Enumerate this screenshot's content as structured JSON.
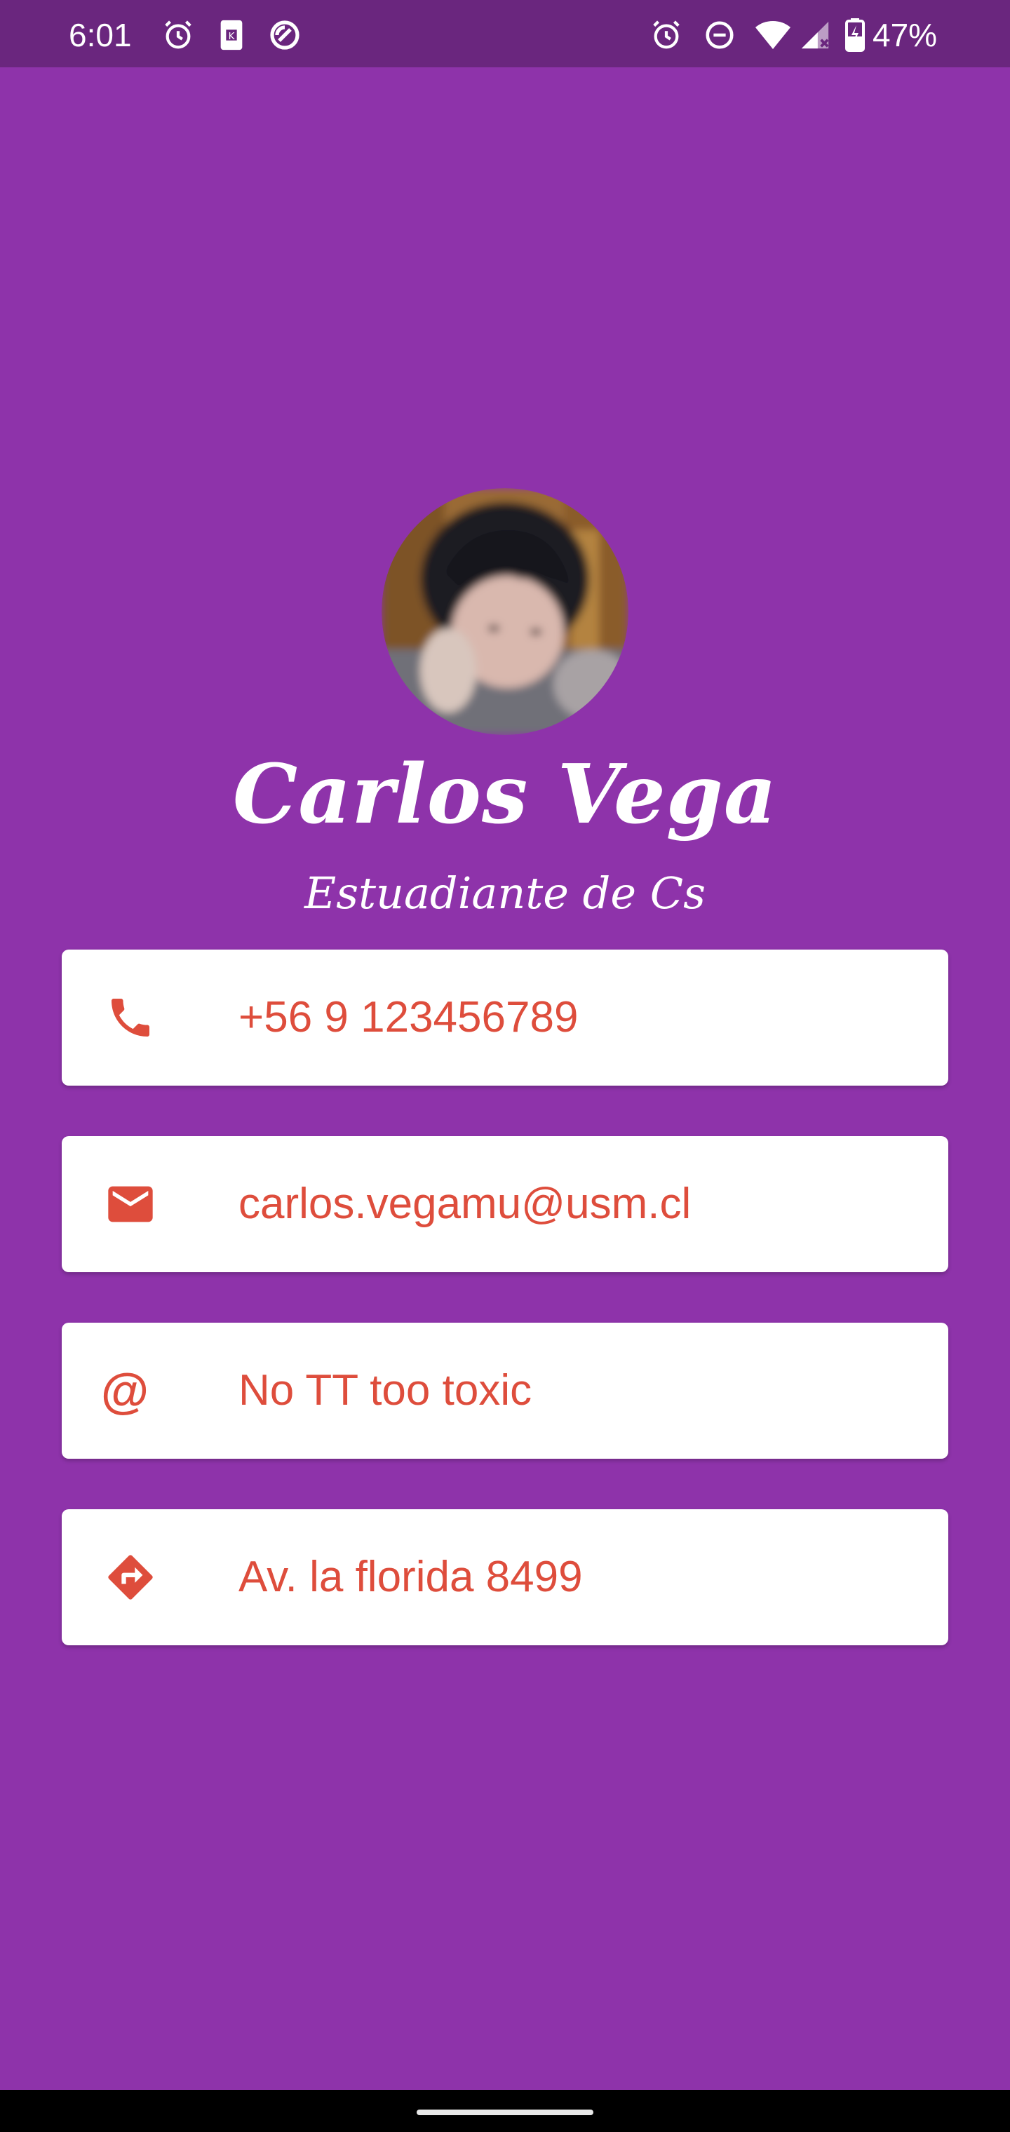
{
  "status_bar": {
    "time": "6:01",
    "battery_percent": "47%",
    "left_icons": [
      "alarm-icon",
      "sim-card-icon",
      "sync-icon"
    ],
    "right_icons": [
      "alarm-icon",
      "do-not-disturb-icon",
      "wifi-icon",
      "signal-icon",
      "battery-charging-icon"
    ]
  },
  "profile": {
    "name": "Carlos Vega",
    "subtitle": "Estuadiante de Cs"
  },
  "contacts": [
    {
      "icon": "phone-icon",
      "text": "+56 9 123456789"
    },
    {
      "icon": "email-icon",
      "text": "carlos.vegamu@usm.cl"
    },
    {
      "icon": "at-icon",
      "glyph": "@",
      "text": "No TT too toxic"
    },
    {
      "icon": "directions-icon",
      "text": "Av. la florida 8499"
    }
  ],
  "colors": {
    "background": "#8e33aa",
    "status_bar": "#6a267e",
    "accent": "#de4d3c",
    "card": "#ffffff"
  }
}
